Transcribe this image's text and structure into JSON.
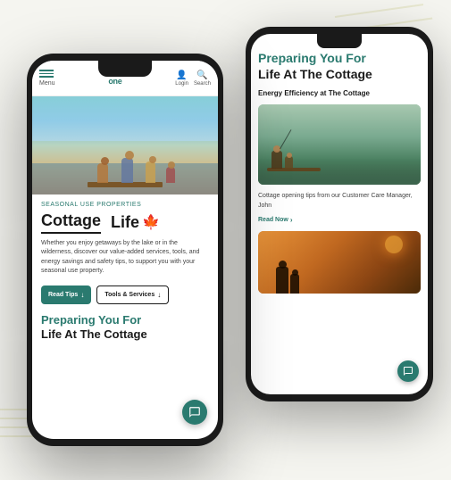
{
  "app": {
    "title": "Hydro One"
  },
  "front_phone": {
    "header": {
      "menu_label": "Menu",
      "login_label": "Login",
      "search_label": "Search"
    },
    "hero_alt": "Family sitting on dock",
    "seasonal_tag": "Seasonal Use Properties",
    "cottage_title_part1": "Cottage",
    "cottage_title_part2": "Life",
    "cottage_maple": "🍁",
    "description": "Whether you enjoy getaways by the lake or in the wilderness, discover our value-added services, tools, and energy savings and safety tips, to support you with your seasonal use property.",
    "button_read_tips": "Read Tips",
    "button_arrow": "↓",
    "button_tools": "Tools & Services",
    "section_title_line1": "Preparing You For",
    "section_title_line2": "Life At The Cottage"
  },
  "back_phone": {
    "main_title_line1": "Preparing You For",
    "main_title_line2": "Life At The Cottage",
    "subtitle": "Energy Efficiency at The Cottage",
    "card_desc": "Cottage opening tips from our Customer Care Manager, John",
    "read_now": "Read Now",
    "read_now_chevron": "›",
    "bottom_img_alt": "Grandfather and grandchild at sunset"
  }
}
